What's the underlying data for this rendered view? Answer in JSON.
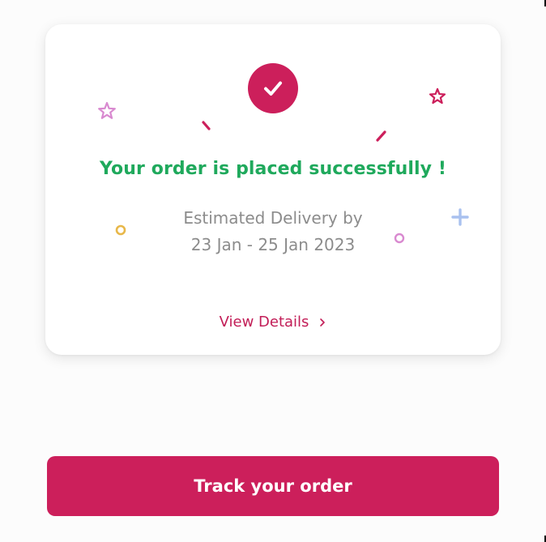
{
  "order_card": {
    "title": "Your order is placed successfully !",
    "delivery_label": "Estimated Delivery by",
    "delivery_dates": "23 Jan - 25 Jan 2023",
    "view_details_label": "View Details",
    "view_details_icon": "chevron-right-icon",
    "status_icon": "checkmark-icon"
  },
  "actions": {
    "track_label": "Track your order"
  },
  "colors": {
    "brand": "#cc1f5b",
    "success_text": "#1fa95c",
    "muted_text": "#8c8c8c",
    "confetti_pink": "#d98ad0",
    "confetti_yellow": "#e8b84a",
    "confetti_blue": "#a9c1ef"
  }
}
